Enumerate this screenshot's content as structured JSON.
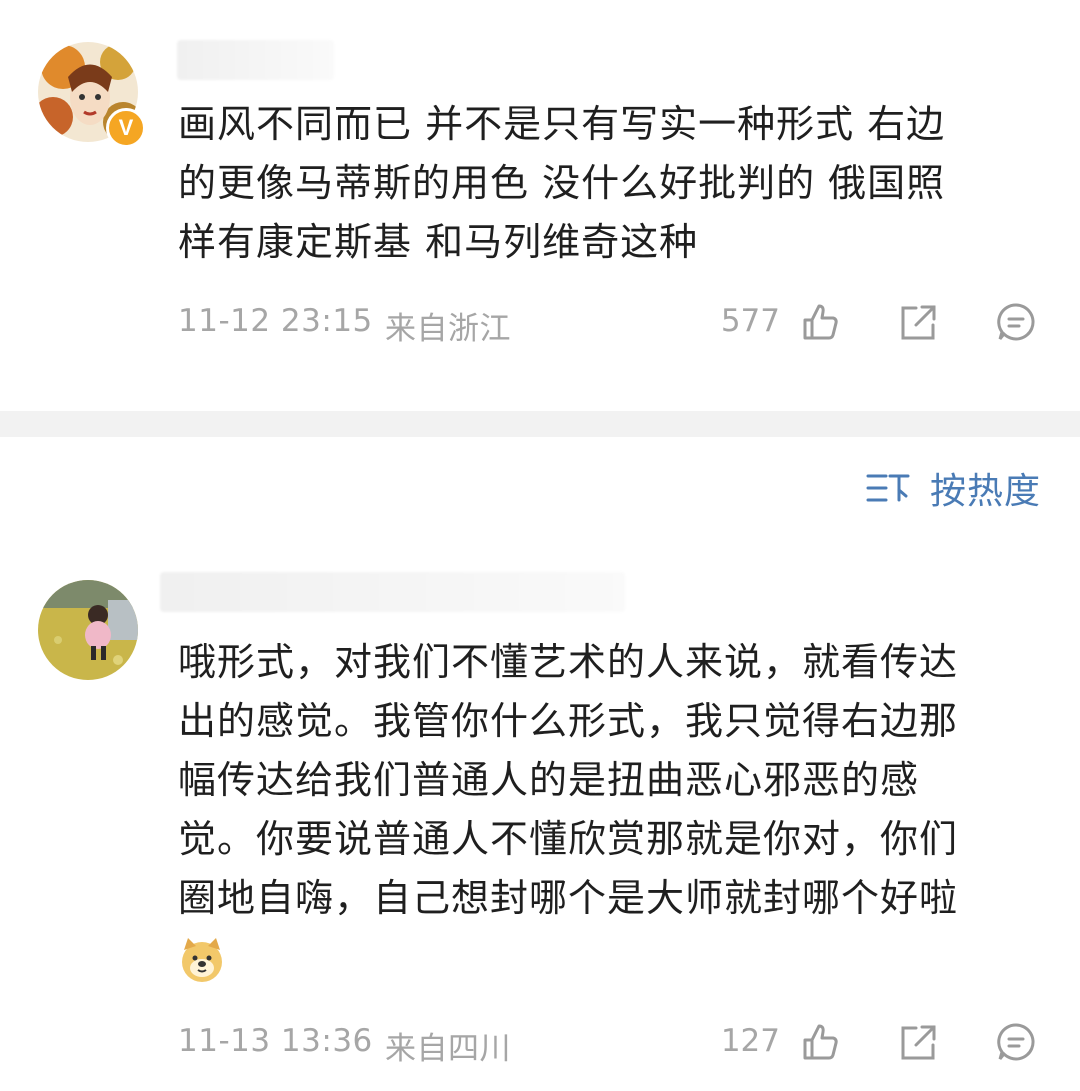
{
  "comments": [
    {
      "text": "画风不同而已 并不是只有写实一种形式 右边\n的更像马蒂斯的用色 没什么好批判的 俄国照\n样有康定斯基 和马列维奇这种",
      "time": "11-12 23:15",
      "location": "来自浙江",
      "likes": "577",
      "verified": "V"
    },
    {
      "text": "哦形式，对我们不懂艺术的人来说，就看传达\n出的感觉。我管你什么形式，我只觉得右边那\n幅传达给我们普通人的是扭曲恶心邪恶的感\n觉。你要说普通人不懂欣赏那就是你对，你们\n圈地自嗨，自己想封哪个是大师就封哪个好啦",
      "time": "11-13 13:36",
      "location": "来自四川",
      "likes": "127"
    }
  ],
  "sort": {
    "label": "按热度"
  },
  "colors": {
    "accent": "#4a7bb5",
    "meta": "#a6a6a6",
    "badge": "#f5a623"
  },
  "icons": [
    "like-icon",
    "share-icon",
    "reply-icon",
    "sort-icon",
    "doge-emoji-icon"
  ]
}
